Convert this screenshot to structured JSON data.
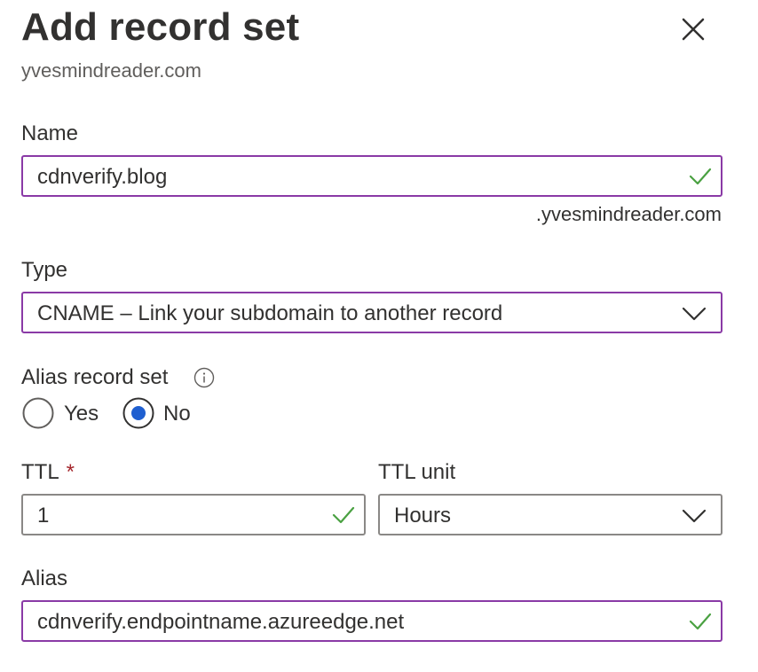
{
  "header": {
    "title": "Add record set",
    "subtitle": "yvesmindreader.com"
  },
  "name_field": {
    "label": "Name",
    "value": "cdnverify.blog",
    "suffix": ".yvesmindreader.com",
    "valid": true
  },
  "type_field": {
    "label": "Type",
    "selected": "CNAME – Link your subdomain to another record"
  },
  "alias_record_set": {
    "label": "Alias record set",
    "options": [
      "Yes",
      "No"
    ],
    "selected": "No"
  },
  "ttl_field": {
    "label": "TTL",
    "required_marker": "*",
    "value": "1",
    "valid": true
  },
  "ttl_unit_field": {
    "label": "TTL unit",
    "selected": "Hours"
  },
  "alias_field": {
    "label": "Alias",
    "value": "cdnverify.endpointname.azureedge.net",
    "valid": true
  },
  "colors": {
    "focus_border": "#8a3aa6",
    "check": "#4aa142",
    "radio_selected": "#1f5fd0",
    "required": "#a4262c"
  },
  "icons": {
    "close": "close-icon",
    "check": "checkmark-icon",
    "chevron": "chevron-down-icon",
    "info": "info-icon"
  }
}
